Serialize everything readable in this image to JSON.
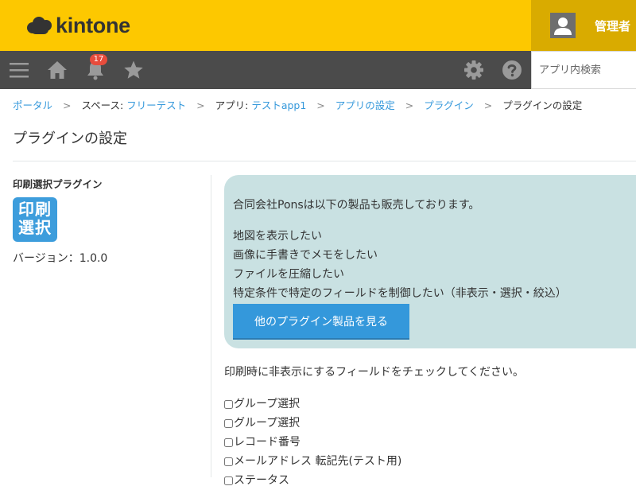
{
  "header": {
    "logo_text": "kintone",
    "user_name": "管理者"
  },
  "navbar": {
    "icons": [
      "menu-icon",
      "home-icon",
      "bell-icon",
      "star-icon",
      "gear-icon",
      "help-icon"
    ],
    "notification_count": "17",
    "search_placeholder": "アプリ内検索"
  },
  "breadcrumb": {
    "portal": "ポータル",
    "space_prefix": "スペース: ",
    "space_name": "フリーテスト",
    "app_prefix": "アプリ: ",
    "app_name": "テストapp1",
    "app_settings": "アプリの設定",
    "plugins": "プラグイン",
    "current": "プラグインの設定",
    "separator": ">"
  },
  "page": {
    "title": "プラグインの設定"
  },
  "plugin": {
    "name": "印刷選択プラグイン",
    "icon_line1": "印刷",
    "icon_line2": "選択",
    "version": "バージョン：1.0.0"
  },
  "promo": {
    "heading": "合同会社Ponsは以下の製品も販売しております。",
    "items": [
      "地図を表示したい",
      "画像に手書きでメモをしたい",
      "ファイルを圧縮したい",
      "特定条件で特定のフィールドを制御したい（非表示・選択・絞込）"
    ],
    "button_label": "他のプラグイン製品を見る"
  },
  "settings": {
    "instruction": "印刷時に非表示にするフィールドをチェックしてください。",
    "fields": [
      "グループ選択",
      "グループ選択",
      "レコード番号",
      "メールアドレス 転記先(テスト用)",
      "ステータス"
    ]
  },
  "colors": {
    "header_yellow": "#fdc800",
    "navbar_dark": "#4b4b4b",
    "link_blue": "#3498db",
    "promo_bg": "#c9e1e2",
    "badge_red": "#e74c3c"
  }
}
